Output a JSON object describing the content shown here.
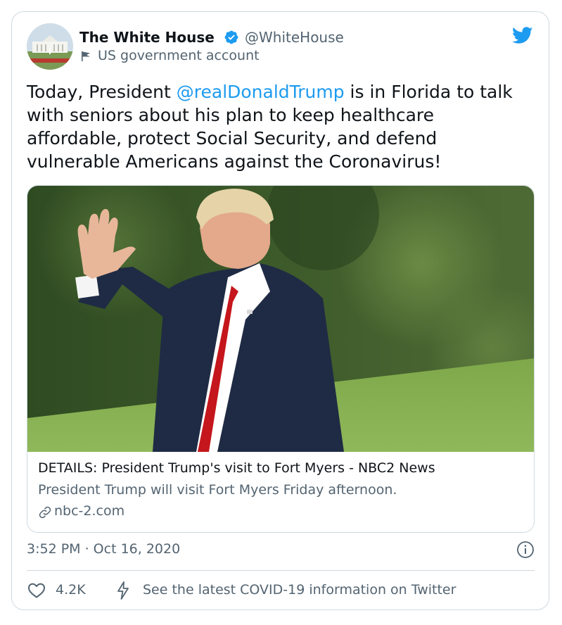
{
  "tweet": {
    "author_name": "The White House",
    "author_handle": "@WhiteHouse",
    "account_label": "US government account",
    "text_before": "Today, President ",
    "mention": "@realDonaldTrump",
    "text_after": " is in Florida to talk with seniors about his plan to keep healthcare affordable, protect Social Security, and defend vulnerable Americans against the Coronavirus!",
    "timestamp": "3:52 PM · Oct 16, 2020"
  },
  "link_card": {
    "title": "DETAILS: President Trump's visit to Fort Myers - NBC2 News",
    "description": "President Trump will visit Fort Myers Friday afternoon.",
    "domain": "nbc-2.com",
    "image_subject": "president-waving-photo"
  },
  "actions": {
    "like_count": "4.2K",
    "info_link": "See the latest COVID-19 information on Twitter"
  },
  "icons": {
    "verified": "verified-badge-icon",
    "government": "government-flag-icon",
    "brand": "twitter-bird-icon",
    "link": "link-icon",
    "info": "info-icon",
    "like": "heart-icon",
    "covid": "lightning-icon"
  },
  "colors": {
    "accent": "#1d9bf0",
    "text_primary": "#0f1419",
    "text_secondary": "#536471",
    "border": "#cfd9de"
  }
}
